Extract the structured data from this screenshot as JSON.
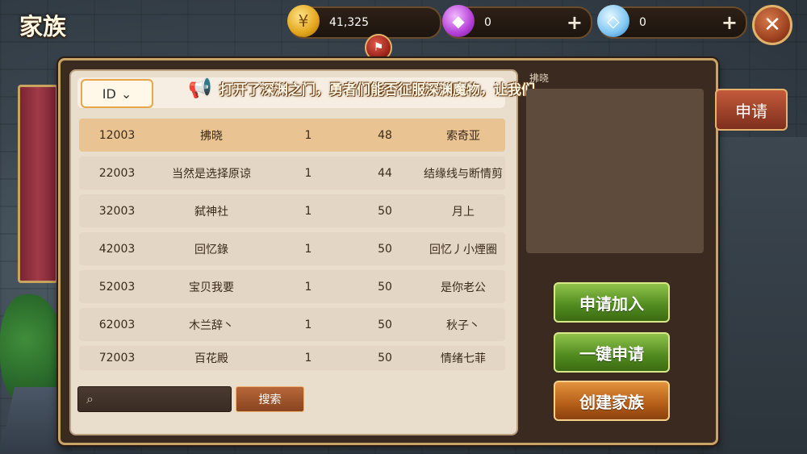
{
  "header": {
    "title": "家族"
  },
  "resources": {
    "gold": {
      "value": "41,325",
      "icon": "gold-coin-icon"
    },
    "gem": {
      "value": "0",
      "icon": "purple-gem-icon",
      "plus": "+"
    },
    "diamond": {
      "value": "0",
      "icon": "diamond-icon",
      "plus": "+"
    }
  },
  "close_label": "✕",
  "list": {
    "sort_label": "ID",
    "ticker": "打开了深渊之门，勇者们能否征服深渊魔物，让我们",
    "ticker_tag": "拂晓",
    "rows": [
      {
        "id": "12003",
        "name": "拂晓",
        "level": "1",
        "members": "48",
        "leader": "索奇亚"
      },
      {
        "id": "22003",
        "name": "当然是选择原谅",
        "level": "1",
        "members": "44",
        "leader": "结缘线与断情剪"
      },
      {
        "id": "32003",
        "name": "弑神社",
        "level": "1",
        "members": "50",
        "leader": "月上"
      },
      {
        "id": "42003",
        "name": "回忆錄",
        "level": "1",
        "members": "50",
        "leader": "回忆丿小煙圈"
      },
      {
        "id": "52003",
        "name": "宝贝我要",
        "level": "1",
        "members": "50",
        "leader": "是你老公"
      },
      {
        "id": "62003",
        "name": "木兰辞丶",
        "level": "1",
        "members": "50",
        "leader": "秋子丶"
      },
      {
        "id": "72003",
        "name": "百花殿",
        "level": "1",
        "members": "50",
        "leader": "情绪七菲"
      }
    ]
  },
  "search": {
    "value": "",
    "placeholder": "",
    "button": "搜索"
  },
  "side_tab": "申请",
  "actions": {
    "apply": "申请加入",
    "one_key": "一键申请",
    "create": "创建家族"
  },
  "colors": {
    "accent_green": "#4f8a1e",
    "accent_orange": "#b45d18",
    "selected_row": "#eac393"
  }
}
